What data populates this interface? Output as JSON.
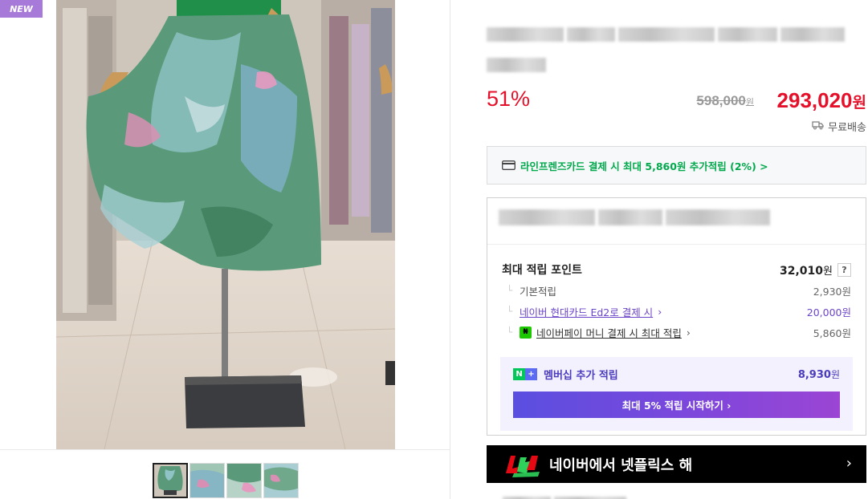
{
  "badge": {
    "new_label": "NEW"
  },
  "pricing": {
    "discount": "51%",
    "original_price": "598,000",
    "original_unit": "원",
    "sale_price": "293,020",
    "sale_unit": "원",
    "shipping": "무료배송"
  },
  "card_benefit": {
    "text": "라인프렌즈카드 결제 시 최대 5,860원 추가적립 (2%) >"
  },
  "points": {
    "total_label": "최대 적립 포인트",
    "total_value": "32,010",
    "total_unit": "원",
    "help": "?",
    "rows": [
      {
        "label": "기본적립",
        "value": "2,930원"
      },
      {
        "label": "네이버 현대카드 Ed2로 결제 시",
        "chevron": "›",
        "value": "20,000원"
      },
      {
        "label": "네이버페이 머니 결제 시 최대 적립",
        "chevron": "›",
        "value": "5,860원"
      }
    ]
  },
  "membership": {
    "n_badge": "N",
    "plus_badge": "+",
    "label": "멤버십 추가 적립",
    "value": "8,930",
    "unit": "원",
    "button": "최대 5% 적립 시작하기 ›"
  },
  "netflix": {
    "text": "네이버에서 넷플릭스 해",
    "chevron": "›"
  },
  "colors": {
    "accent_red": "#e5112a",
    "naver_green": "#03a94d",
    "membership_purple": "#4b3bbd",
    "badge_purple": "#a77ad9"
  }
}
